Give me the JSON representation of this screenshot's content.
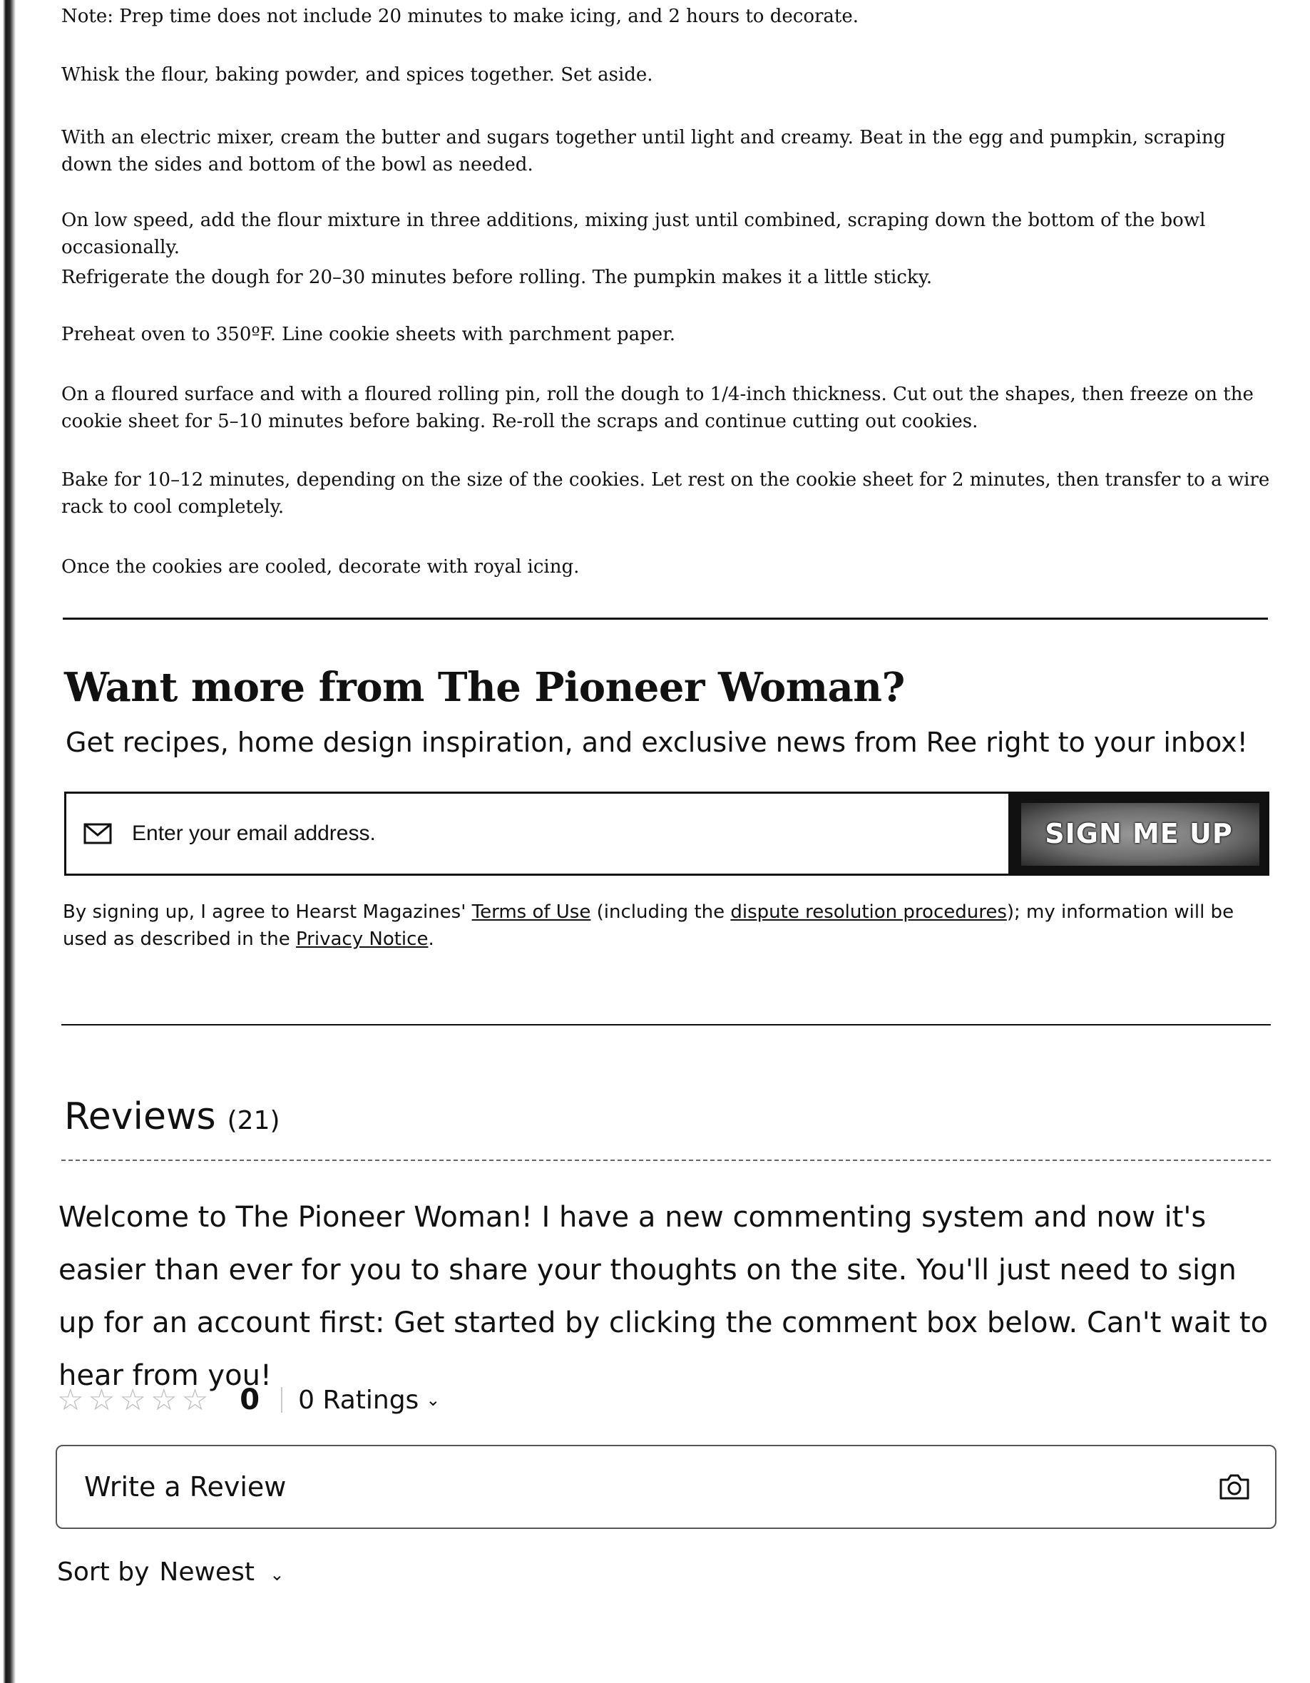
{
  "directions": {
    "steps": [
      "Note: Prep time does not include 20 minutes to make icing, and 2 hours to decorate.",
      "Whisk the flour, baking powder, and spices together. Set aside.",
      "With an electric mixer, cream the butter and sugars together until light and creamy. Beat in the egg and pumpkin, scraping down the sides and bottom of the bowl as needed.",
      "On low speed, add the flour mixture in three additions, mixing just until combined, scraping down the bottom of the bowl occasionally.",
      "Refrigerate the dough for 20–30 minutes before rolling. The pumpkin makes it a little sticky.",
      "Preheat oven to 350ºF. Line cookie sheets with parchment paper.",
      "On a floured surface and with a floured rolling pin, roll the dough to 1/4-inch thickness. Cut out the shapes, then freeze on the cookie sheet for 5–10 minutes before baking. Re-roll the scraps and continue cutting out cookies.",
      "Bake for 10–12 minutes, depending on the size of the cookies. Let rest on the cookie sheet for 2 minutes, then transfer to a wire rack to cool completely.",
      "Once the cookies are cooled, decorate with royal icing."
    ]
  },
  "newsletter": {
    "title": "Want more from The Pioneer Woman?",
    "subtitle": "Get recipes, home design inspiration, and exclusive news from Ree right to your inbox!",
    "email_placeholder": "Enter your email address.",
    "email_icon": "envelope-icon",
    "button_label": "SIGN ME UP",
    "disclaimer": {
      "part1": "By signing up, I agree to Hearst Magazines' ",
      "terms_link": "Terms of Use",
      "part2": " (including the ",
      "dispute_link": "dispute resolution procedures",
      "part3": "); my information will be used as described in the ",
      "privacy_link": "Privacy Notice",
      "part4": "."
    }
  },
  "reviews": {
    "title": "Reviews",
    "count": "(21)",
    "welcome": "Welcome to The Pioneer Woman! I have a new commenting system and now it's easier than ever for you to share your thoughts on the site. You'll just need to sign up for an account first: Get started by clicking the comment box below. Can't wait to hear from you!",
    "rating_value": "0",
    "ratings_label": "0 Ratings",
    "stars_filled": 0,
    "stars_total": 5,
    "write_review_placeholder": "Write a Review",
    "camera_icon": "camera-icon",
    "sort_label": "Sort by",
    "sort_value": "Newest"
  }
}
